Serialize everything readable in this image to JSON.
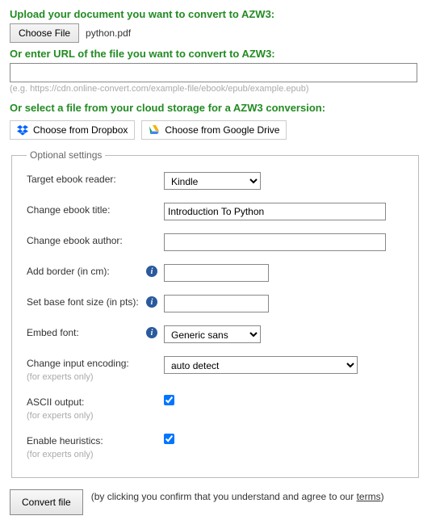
{
  "section1": {
    "heading": "Upload your document you want to convert to AZW3:",
    "choose_btn": "Choose File",
    "filename": "python.pdf"
  },
  "section2": {
    "heading": "Or enter URL of the file you want to convert to AZW3:",
    "url_value": "",
    "hint": "(e.g. https://cdn.online-convert.com/example-file/ebook/epub/example.epub)"
  },
  "section3": {
    "heading": "Or select a file from your cloud storage for a AZW3 conversion:",
    "dropbox": "Choose from Dropbox",
    "gdrive": "Choose from Google Drive"
  },
  "fieldset": {
    "legend": "Optional settings",
    "target_reader": {
      "label": "Target ebook reader:",
      "value": "Kindle"
    },
    "title": {
      "label": "Change ebook title:",
      "value": "Introduction To Python"
    },
    "author": {
      "label": "Change ebook author:",
      "value": ""
    },
    "border": {
      "label": "Add border (in cm):",
      "value": ""
    },
    "fontsize": {
      "label": "Set base font size (in pts):",
      "value": ""
    },
    "embed": {
      "label": "Embed font:",
      "value": "Generic sans"
    },
    "encoding": {
      "label": "Change input encoding:",
      "sub": "(for experts only)",
      "value": "auto detect"
    },
    "ascii": {
      "label": "ASCII output:",
      "sub": "(for experts only)"
    },
    "heur": {
      "label": "Enable heuristics:",
      "sub": "(for experts only)"
    }
  },
  "footer": {
    "convert": "Convert file",
    "note_a": "(by clicking you confirm that you understand and agree to our ",
    "terms": "terms",
    "note_b": ")"
  }
}
